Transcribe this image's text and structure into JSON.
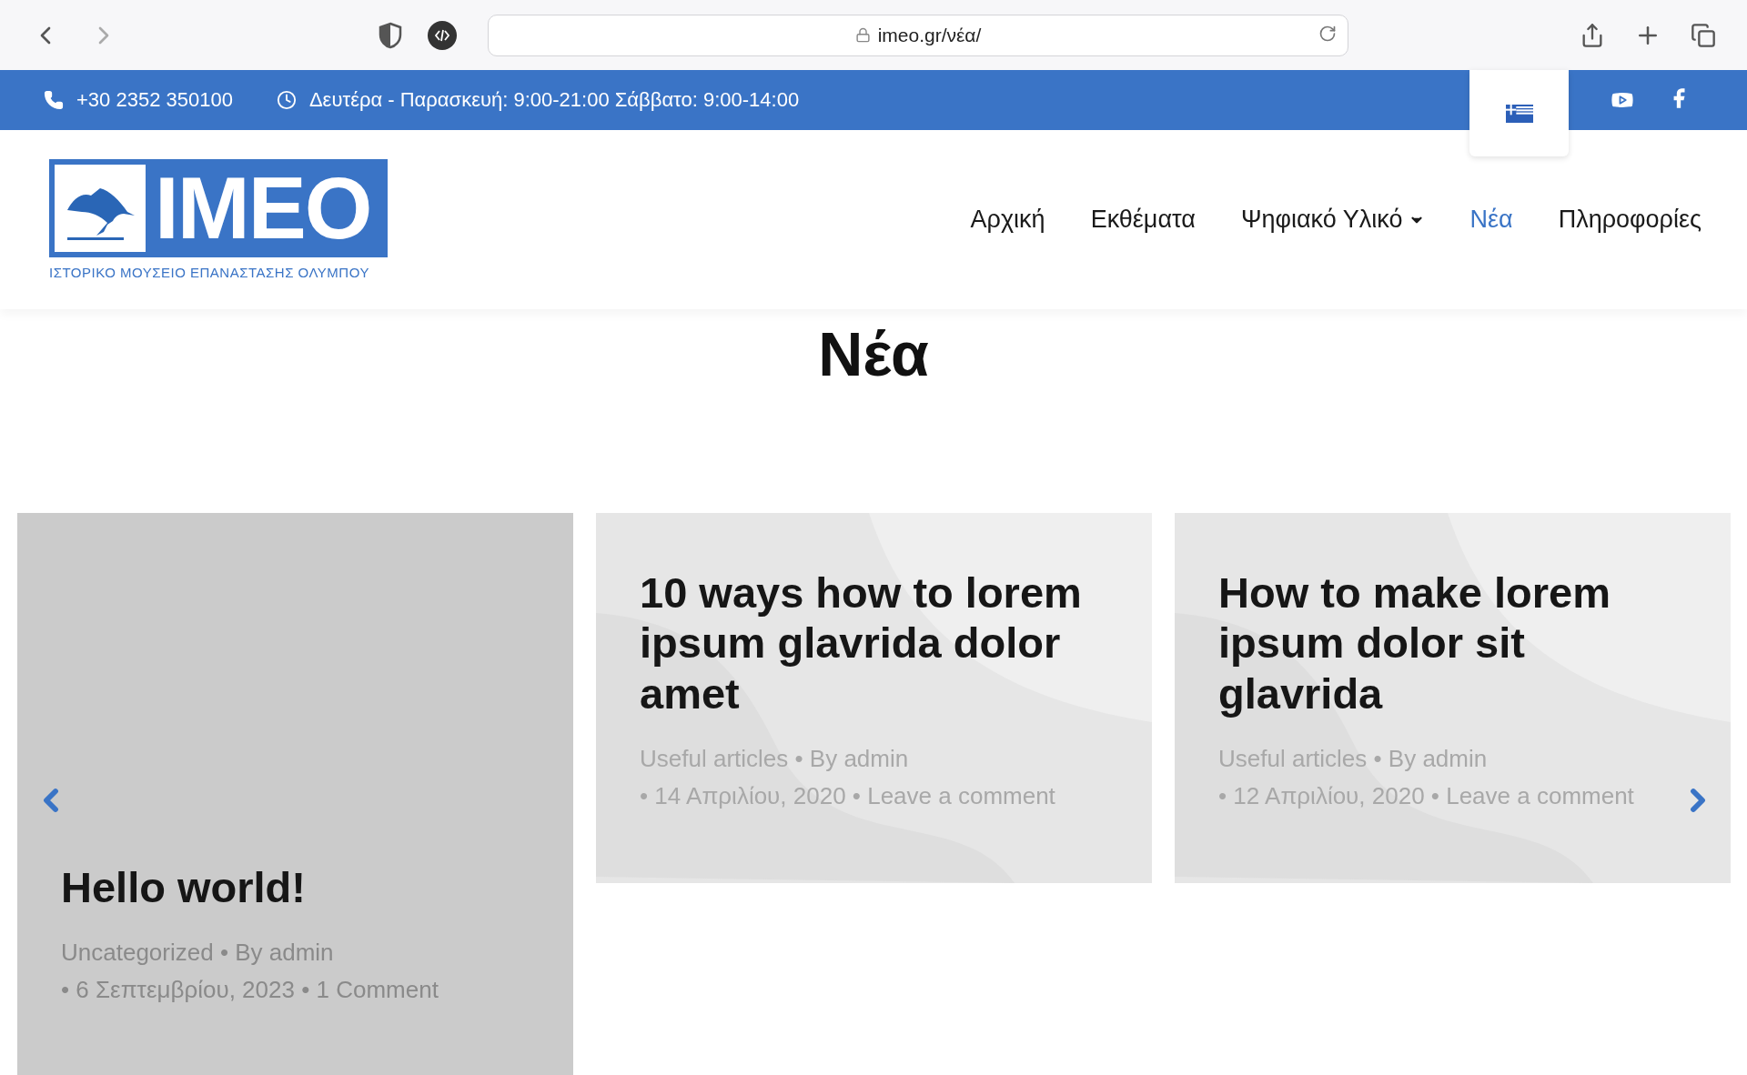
{
  "browser": {
    "url": "imeo.gr/νέα/"
  },
  "topbar": {
    "phone": "+30 2352 350100",
    "hours": "Δευτέρα - Παρασκευή: 9:00-21:00 Σάββατο: 9:00-14:00"
  },
  "logo": {
    "wordmark": "IMEO",
    "subtitle": "ΙΣΤΟΡΙΚΟ ΜΟΥΣΕΙΟ ΕΠΑΝΑΣΤΑΣΗΣ ΟΛΥΜΠΟΥ"
  },
  "nav": [
    {
      "label": "Αρχική",
      "selected": false,
      "has_menu": false
    },
    {
      "label": "Εκθέματα",
      "selected": false,
      "has_menu": false
    },
    {
      "label": "Ψηφιακό Υλικό",
      "selected": false,
      "has_menu": true
    },
    {
      "label": "Νέα",
      "selected": true,
      "has_menu": false
    },
    {
      "label": "Πληροφορίες",
      "selected": false,
      "has_menu": false
    }
  ],
  "page_title": "Νέα",
  "posts": [
    {
      "kind": "photo",
      "title": "Hello world!",
      "meta_1": "Uncategorized • By admin",
      "meta_2": "• 6 Σεπτεμβρίου, 2023 • 1 Comment"
    },
    {
      "kind": "pattern",
      "title": "10 ways how to lorem ipsum glavrida dolor amet",
      "meta_1": "Useful articles • By admin",
      "meta_2": "• 14 Απριλίου, 2020 • Leave a comment"
    },
    {
      "kind": "pattern",
      "title": "How to make lorem ipsum dolor sit glavrida",
      "meta_1": "Useful articles • By admin",
      "meta_2": "• 12 Απριλίου, 2020 • Leave a comment"
    }
  ]
}
